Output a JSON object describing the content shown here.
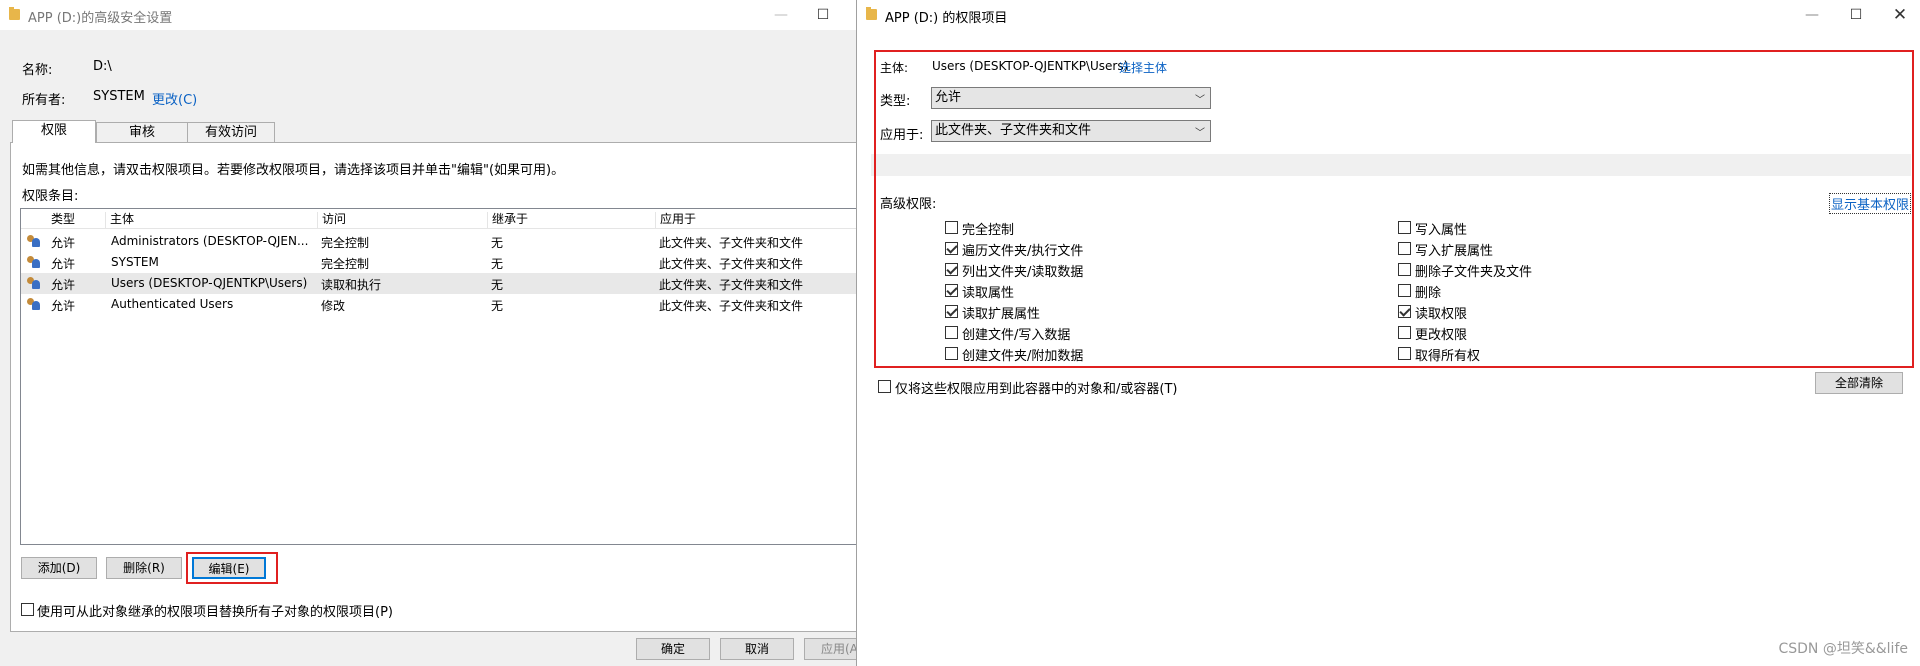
{
  "left": {
    "title": "APP (D:)的高级安全设置",
    "name_label": "名称:",
    "name_value": "D:\\",
    "owner_label": "所有者:",
    "owner_value": "SYSTEM",
    "change_link": "更改(C)",
    "tabs": [
      {
        "label": "权限"
      },
      {
        "label": "审核"
      },
      {
        "label": "有效访问"
      }
    ],
    "info": "如需其他信息，请双击权限项目。若要修改权限项目，请选择该项目并单击\"编辑\"(如果可用)。",
    "entries_label": "权限条目:",
    "columns": [
      "类型",
      "主体",
      "访问",
      "继承于",
      "应用于"
    ],
    "rows": [
      {
        "type": "允许",
        "principal": "Administrators (DESKTOP-QJEN...",
        "access": "完全控制",
        "inherited": "无",
        "applies": "此文件夹、子文件夹和文件"
      },
      {
        "type": "允许",
        "principal": "SYSTEM",
        "access": "完全控制",
        "inherited": "无",
        "applies": "此文件夹、子文件夹和文件"
      },
      {
        "type": "允许",
        "principal": "Users (DESKTOP-QJENTKP\\Users)",
        "access": "读取和执行",
        "inherited": "无",
        "applies": "此文件夹、子文件夹和文件"
      },
      {
        "type": "允许",
        "principal": "Authenticated Users",
        "access": "修改",
        "inherited": "无",
        "applies": "此文件夹、子文件夹和文件"
      }
    ],
    "add_btn": "添加(D)",
    "remove_btn": "删除(R)",
    "edit_btn": "编辑(E)",
    "replace_label": "使用可从此对象继承的权限项目替换所有子对象的权限项目(P)",
    "ok_btn": "确定",
    "cancel_btn": "取消",
    "apply_btn": "应用(A)"
  },
  "right": {
    "title": "APP (D:) 的权限项目",
    "principal_label": "主体:",
    "principal_value": "Users (DESKTOP-QJENTKP\\Users)",
    "select_principal": "选择主体",
    "type_label": "类型:",
    "type_value": "允许",
    "applies_label": "应用于:",
    "applies_value": "此文件夹、子文件夹和文件",
    "adv_label": "高级权限:",
    "show_basic": "显示基本权限",
    "perms_left": [
      {
        "label": "完全控制",
        "checked": false
      },
      {
        "label": "遍历文件夹/执行文件",
        "checked": true
      },
      {
        "label": "列出文件夹/读取数据",
        "checked": true
      },
      {
        "label": "读取属性",
        "checked": true
      },
      {
        "label": "读取扩展属性",
        "checked": true
      },
      {
        "label": "创建文件/写入数据",
        "checked": false
      },
      {
        "label": "创建文件夹/附加数据",
        "checked": false
      }
    ],
    "perms_right": [
      {
        "label": "写入属性",
        "checked": false
      },
      {
        "label": "写入扩展属性",
        "checked": false
      },
      {
        "label": "删除子文件夹及文件",
        "checked": false
      },
      {
        "label": "删除",
        "checked": false
      },
      {
        "label": "读取权限",
        "checked": true
      },
      {
        "label": "更改权限",
        "checked": false
      },
      {
        "label": "取得所有权",
        "checked": false
      }
    ],
    "only_apply_label": "仅将这些权限应用到此容器中的对象和/或容器(T)",
    "clear_all_btn": "全部清除"
  },
  "watermark": "CSDN @坦笑&&life"
}
